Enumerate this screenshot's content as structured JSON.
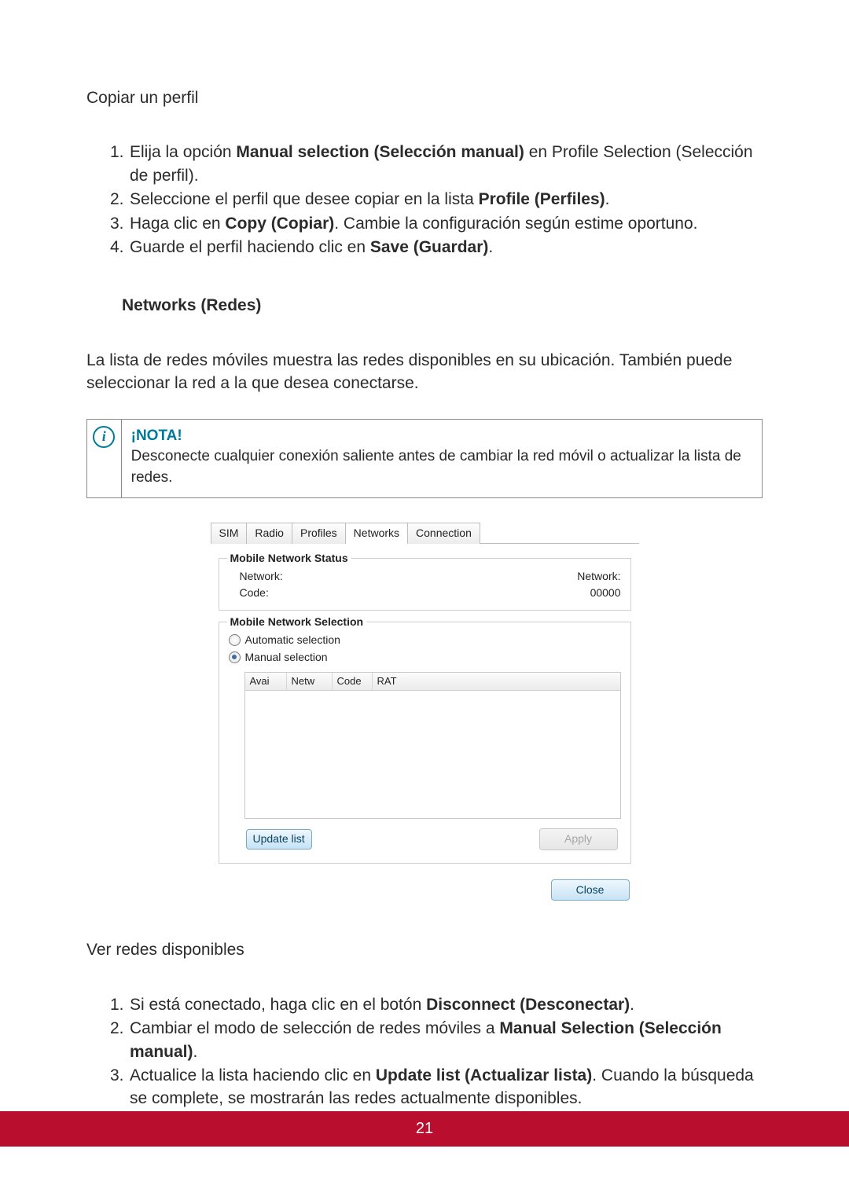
{
  "heading_copy": "Copiar un perfil",
  "copy_steps": [
    {
      "before": "Elija la opción ",
      "bold": "Manual selection (Selección manual)",
      "after": " en Profile Selection (Selección de perfil)."
    },
    {
      "before": "Seleccione el perfil que desee copiar en la lista ",
      "bold": "Profile (Perfiles)",
      "after": "."
    },
    {
      "before": "Haga clic en  ",
      "bold": "Copy (Copiar)",
      "after": ". Cambie la configuración según estime oportuno."
    },
    {
      "before": "Guarde el perfil haciendo clic en ",
      "bold": "Save (Guardar)",
      "after": "."
    }
  ],
  "subheading_networks": "Networks (Redes)",
  "networks_intro": "La lista de redes móviles muestra las redes disponibles en su ubicación. También puede seleccionar la red a la que desea conectarse.",
  "note": {
    "title": "¡NOTA!",
    "body": "Desconecte cualquier conexión saliente antes de cambiar la red móvil o actualizar la lista de redes."
  },
  "ui": {
    "tabs": [
      "SIM",
      "Radio",
      "Profiles",
      "Networks",
      "Connection"
    ],
    "active_tab_index": 3,
    "status": {
      "legend": "Mobile Network Status",
      "network_label": "Network:",
      "network_value": "Network:",
      "code_label": "Code:",
      "code_value": "00000"
    },
    "selection": {
      "legend": "Mobile Network Selection",
      "auto_label": "Automatic selection",
      "manual_label": "Manual selection",
      "selected": "manual",
      "columns": [
        "Avai",
        "Netw",
        "Code",
        "RAT"
      ],
      "update_button": "Update list",
      "apply_button": "Apply"
    },
    "close_button": "Close"
  },
  "heading_view": "Ver redes disponibles",
  "view_steps": [
    {
      "before": "Si está conectado, haga clic en el botón ",
      "bold": "Disconnect (Desconectar)",
      "after": "."
    },
    {
      "before": "Cambiar el modo de selección de redes móviles a ",
      "bold": "Manual Selection (Selección manual)",
      "after": "."
    },
    {
      "before": "Actualice la lista haciendo clic en ",
      "bold": "Update list (Actualizar lista)",
      "after": ". Cuando la búsqueda se complete, se mostrarán las redes actualmente disponibles."
    }
  ],
  "page_number": "21",
  "info_icon_letter": "i"
}
